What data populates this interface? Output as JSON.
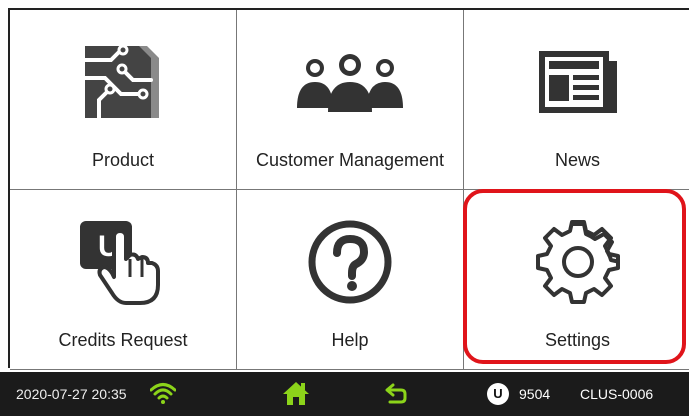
{
  "tiles": [
    {
      "label": "Product",
      "icon": "circuit-board-icon"
    },
    {
      "label": "Customer Management",
      "icon": "people-group-icon"
    },
    {
      "label": "News",
      "icon": "newspaper-icon"
    },
    {
      "label": "Credits Request",
      "icon": "credits-hand-icon"
    },
    {
      "label": "Help",
      "icon": "question-circle-icon"
    },
    {
      "label": "Settings",
      "icon": "gear-icon"
    }
  ],
  "credits_badge_letter": "U",
  "status": {
    "datetime": "2020-07-27 20:35",
    "credits": "9504",
    "device_id": "CLUS-0006"
  },
  "colors": {
    "accent": "#8cd41a",
    "highlight": "#e0141a",
    "icon": "#333333",
    "statusbar": "#1b1b1b"
  }
}
